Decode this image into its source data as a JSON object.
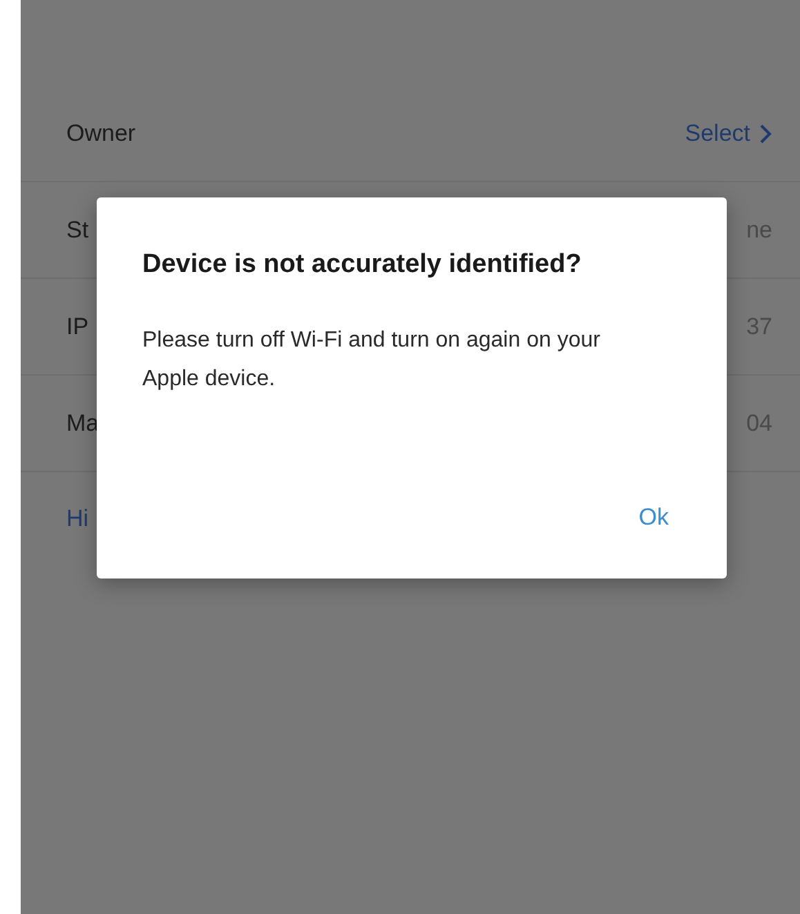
{
  "rows": [
    {
      "label": "Owner",
      "value": "Select",
      "kind": "link"
    },
    {
      "label": "St",
      "value": "ne",
      "kind": "text"
    },
    {
      "label": "IP",
      "value": "37",
      "kind": "text"
    },
    {
      "label": "Ma",
      "value": "04",
      "kind": "text"
    }
  ],
  "link": "Hi",
  "dialog": {
    "title": "Device is not accurately identified?",
    "message": "Please turn off Wi-Fi and turn on again on your Apple device.",
    "button": "Ok"
  }
}
